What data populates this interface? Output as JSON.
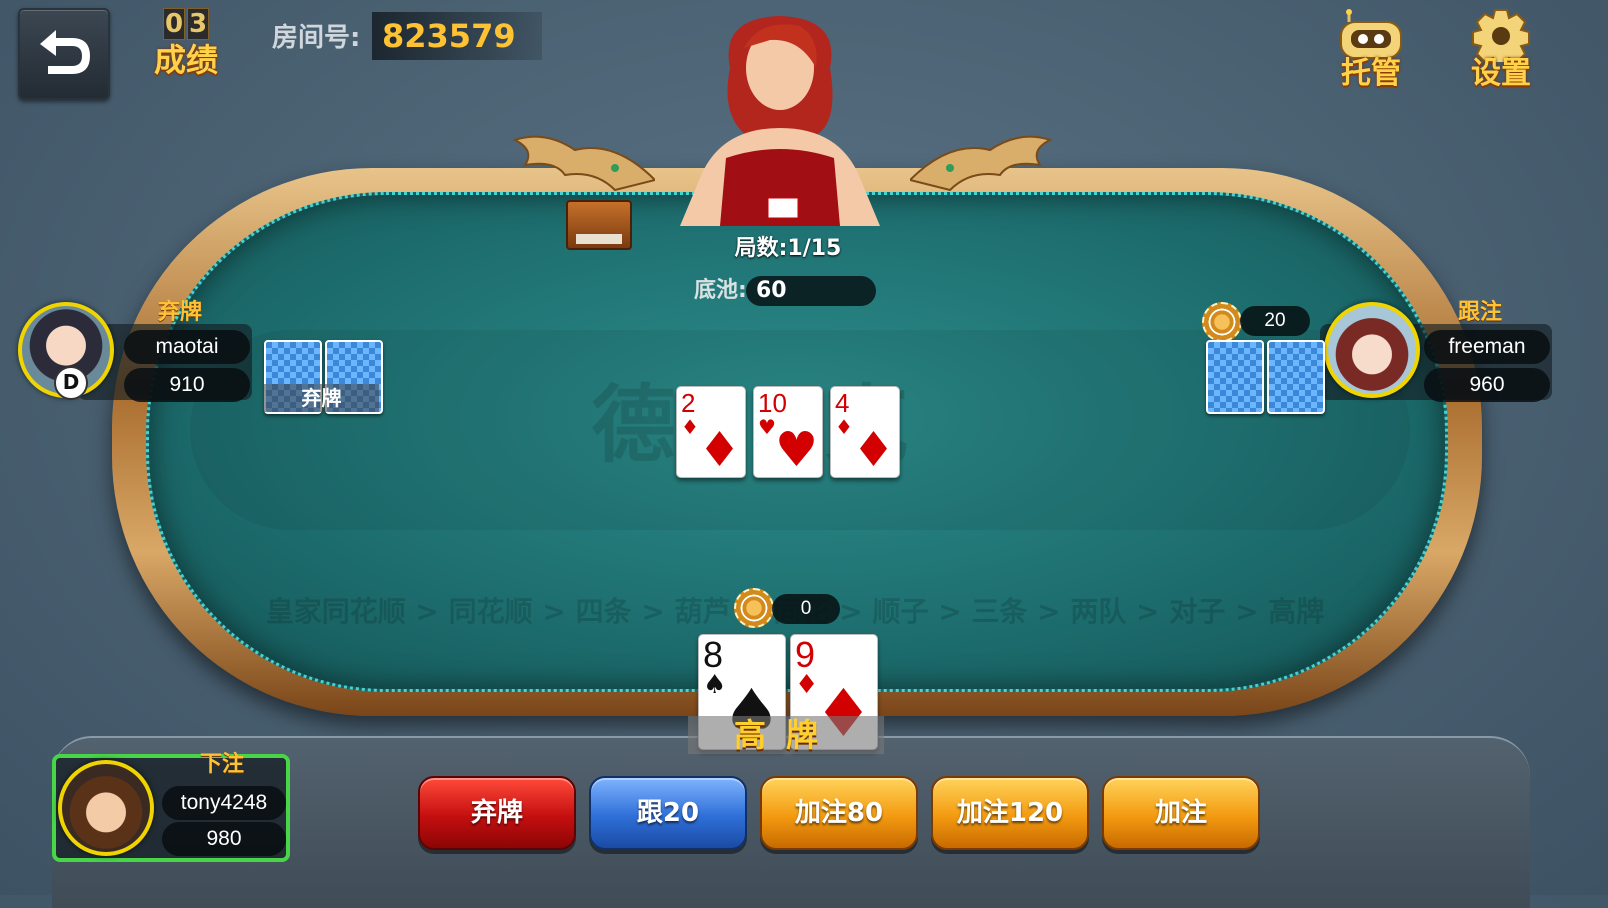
{
  "top_bar": {
    "score_digits": [
      "0",
      "3"
    ],
    "score_label": "成绩",
    "room_label": "房间号:",
    "room_number": "823579",
    "robot_label": "托管",
    "settings_label": "设置"
  },
  "table": {
    "watermark": "德  克",
    "round_text": "局数:1/15",
    "pot_label": "底池:",
    "pot_value": "60",
    "rank_strip": "皇家同花顺 > 同花顺 > 四条 > 葫芦 > 同花 > 顺子 > 三条 > 两队 > 对子 > 高牌",
    "community_cards": [
      {
        "rank": "2",
        "suit": "♦",
        "color": "#d20000"
      },
      {
        "rank": "10",
        "suit": "♥",
        "color": "#d20000"
      },
      {
        "rank": "4",
        "suit": "♦",
        "color": "#d20000"
      }
    ]
  },
  "players": {
    "left": {
      "name": "maotai",
      "chips": "910",
      "status": "弃牌",
      "dealer_marker": "D",
      "folded_label": "弃牌"
    },
    "right": {
      "name": "freeman",
      "chips": "960",
      "status": "跟注",
      "bet": "20"
    },
    "self": {
      "name": "tony4248",
      "chips": "980",
      "status": "下注",
      "bet": "0"
    }
  },
  "my_hand": {
    "cards": [
      {
        "rank": "8",
        "suit": "♠",
        "color": "#111111"
      },
      {
        "rank": "9",
        "suit": "♦",
        "color": "#d20000"
      }
    ],
    "hand_type": "高牌"
  },
  "actions": {
    "fold": "弃牌",
    "call": "跟20",
    "raise_80": "加注80",
    "raise_120": "加注120",
    "raise": "加注"
  },
  "colors": {
    "felt": "#1e6f70",
    "gold_text": "#ffc233",
    "active_border": "#48d648"
  }
}
